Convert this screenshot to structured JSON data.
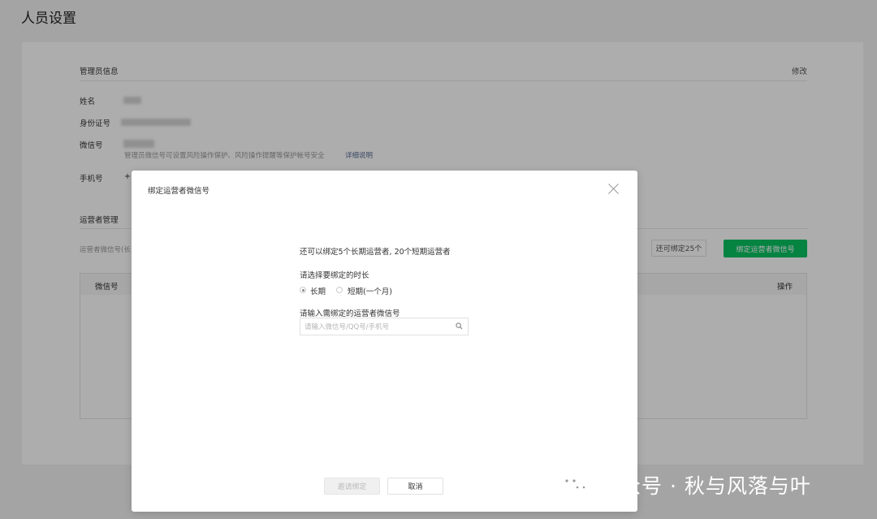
{
  "page": {
    "title": "人员设置"
  },
  "admin_info": {
    "title": "管理员信息",
    "edit_label": "修改",
    "name_label": "姓名",
    "id_label": "身份证号",
    "wechat_label": "微信号",
    "wechat_note": "管理员微信号可设置风险操作保护、风险操作提醒等保护帐号安全",
    "details_link": "详细说明",
    "phone_label": "手机号",
    "phone_value_prefix": "+"
  },
  "operator_mgmt": {
    "title": "运营者管理",
    "desc_fragment": "运营者微信号(长",
    "remaining_button": "还可绑定25个",
    "bind_button": "绑定运营者微信号",
    "table": {
      "col_wechat": "微信号",
      "col_action": "操作"
    }
  },
  "dialog": {
    "title": "绑定运营者微信号",
    "quota_text": "还可以绑定5个长期运营者, 20个短期运营者",
    "duration_label": "请选择要绑定的时长",
    "options": [
      {
        "label": "长期",
        "checked": true
      },
      {
        "label": "短期(一个月)",
        "checked": false
      }
    ],
    "input_label": "请输入需绑定的运营者微信号",
    "input_placeholder": "请输入微信号/QQ号/手机号",
    "input_value": "",
    "invite_button": "邀请绑定",
    "cancel_button": "取消"
  },
  "watermark": {
    "text": "公众号 · 秋与风落与叶"
  },
  "colors": {
    "brand_green": "#07c160",
    "link_blue": "#576b95"
  }
}
